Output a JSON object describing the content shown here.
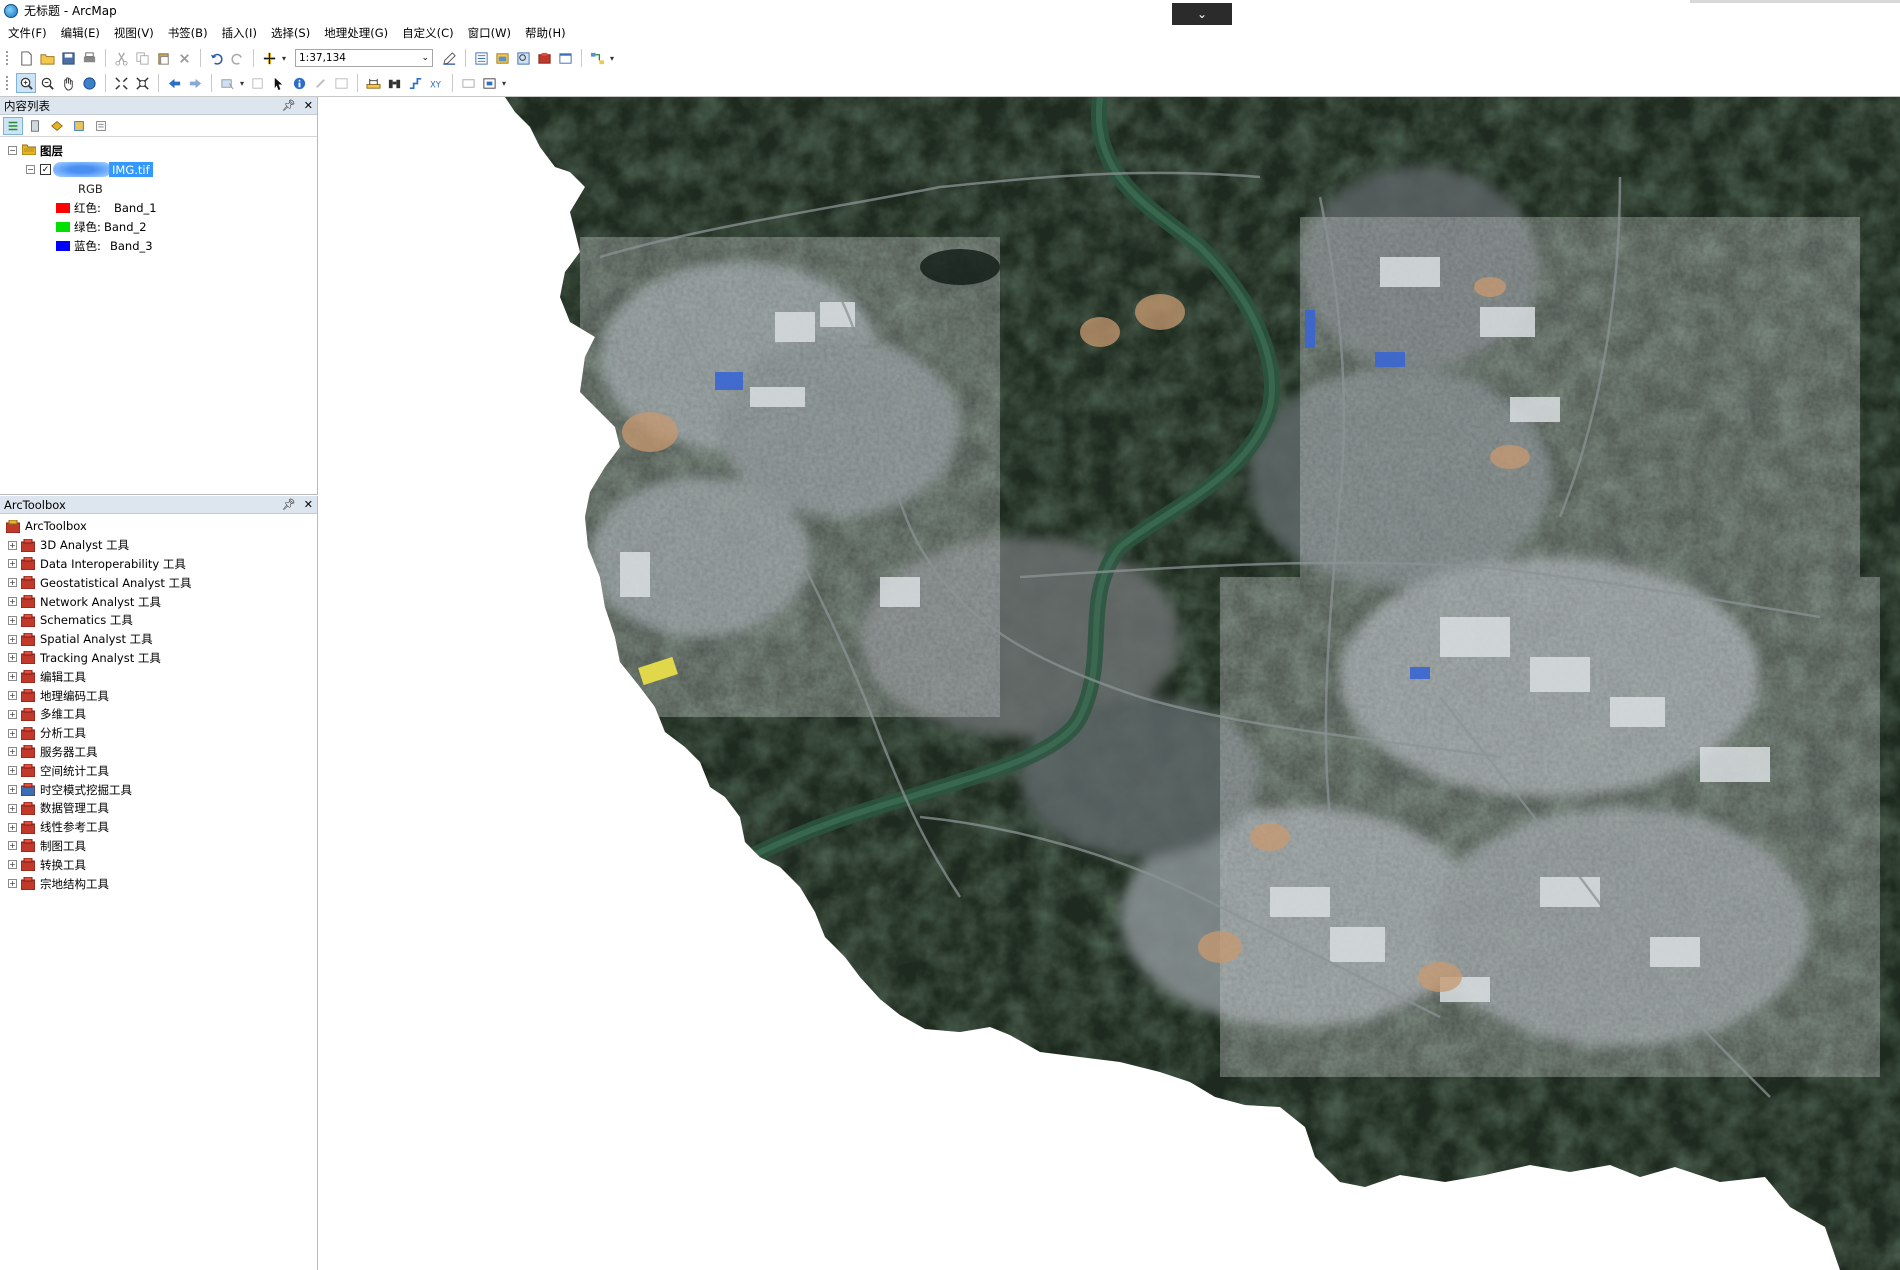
{
  "window": {
    "title": "无标题 - ArcMap"
  },
  "menu": [
    "文件(F)",
    "编辑(E)",
    "视图(V)",
    "书签(B)",
    "插入(I)",
    "选择(S)",
    "地理处理(G)",
    "自定义(C)",
    "窗口(W)",
    "帮助(H)"
  ],
  "toolbar": {
    "scale_value": "1:37,134"
  },
  "toc": {
    "title": "内容列表",
    "root": "图层",
    "layer_name": "IMG.tif",
    "layer_checked": true,
    "composite": "RGB",
    "bands": [
      {
        "label": "红色:",
        "band": "Band_1",
        "color": "#ff0000"
      },
      {
        "label": "绿色:",
        "band": "Band_2",
        "color": "#00e000"
      },
      {
        "label": "蓝色:",
        "band": "Band_3",
        "color": "#0000ff"
      }
    ]
  },
  "arctoolbox": {
    "title": "ArcToolbox",
    "root": "ArcToolbox",
    "items": [
      "3D Analyst 工具",
      "Data Interoperability 工具",
      "Geostatistical Analyst 工具",
      "Network Analyst 工具",
      "Schematics 工具",
      "Spatial Analyst 工具",
      "Tracking Analyst 工具",
      "编辑工具",
      "地理编码工具",
      "多维工具",
      "分析工具",
      "服务器工具",
      "空间统计工具",
      "时空模式挖掘工具",
      "数据管理工具",
      "线性参考工具",
      "制图工具",
      "转换工具",
      "宗地结构工具"
    ]
  },
  "colors": {
    "panel_header": "#dde6ef",
    "selection": "#3399ff",
    "vegetation": "#1f2a20",
    "river": "#2f5a44",
    "urban": "#9aa3a6"
  }
}
